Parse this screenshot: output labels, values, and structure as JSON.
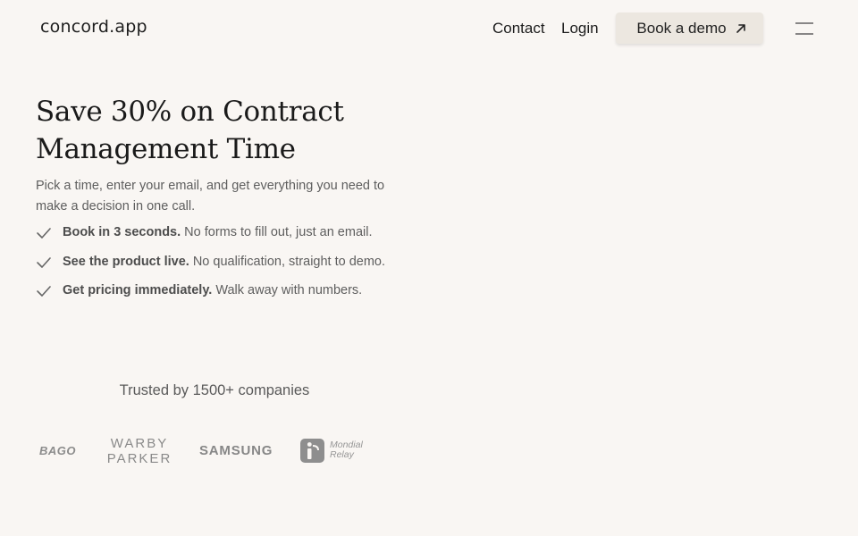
{
  "header": {
    "logo": "concord.app",
    "nav": {
      "contact": "Contact",
      "login": "Login"
    },
    "cta": {
      "label": "Book a demo",
      "icon": "arrow-up-right-icon"
    },
    "menu_icon": "hamburger-menu-icon"
  },
  "hero": {
    "title_line1": "Save 30% on Contract",
    "title_line2": "Management Time",
    "subtitle": "Pick a time, enter your email, and get everything you need to make a decision in one call.",
    "features": [
      {
        "bold": "Book in 3 seconds.",
        "text": "No forms to fill out, just an email."
      },
      {
        "bold": "See the product live.",
        "text": "No qualification, straight to demo."
      },
      {
        "bold": "Get pricing immediately.",
        "text": "Walk away with numbers."
      }
    ]
  },
  "trusted": {
    "label": "Trusted by 1500+ companies",
    "logos": [
      {
        "name": "bago",
        "text": "BAGO"
      },
      {
        "name": "warby-parker",
        "line1": "WARBY",
        "line2": "PARKER"
      },
      {
        "name": "samsung",
        "text": "SAMSUNG"
      },
      {
        "name": "mondial-relay",
        "line1": "Mondial",
        "line2": "Relay"
      }
    ]
  },
  "colors": {
    "background": "#f9f6f3",
    "button_bg": "#ece7e0",
    "text_dark": "#1a1a1a",
    "text_muted": "#5e5e5e",
    "logo_gray": "#8b8b8b"
  }
}
